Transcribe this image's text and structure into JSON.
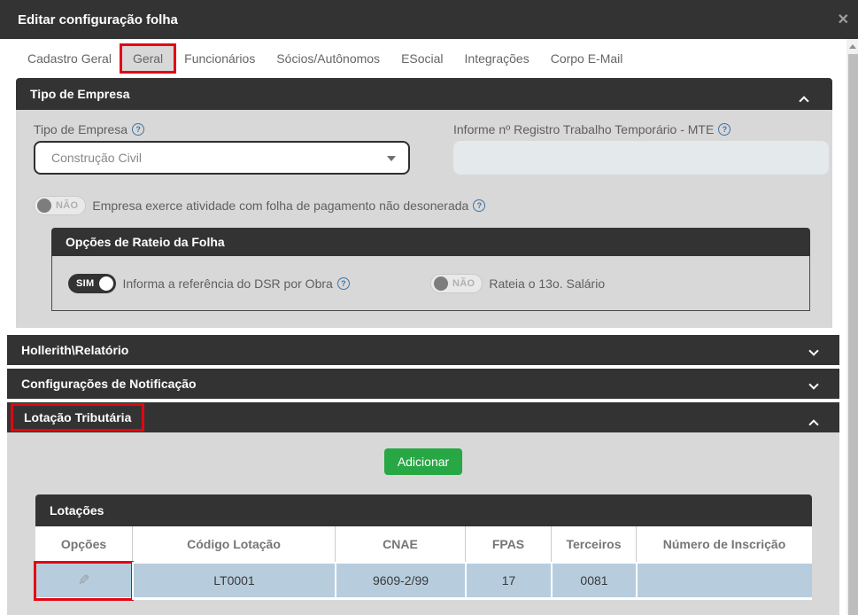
{
  "modal": {
    "title": "Editar configuração folha"
  },
  "icons": {
    "close": "✕",
    "help": "?",
    "pencil": "✎"
  },
  "colors": {
    "header_dark": "#333333",
    "panel_gray": "#d8d8d8",
    "row_blue": "#b7cdde",
    "accent_green": "#28a745",
    "annotation_red": "#e20613",
    "help_blue": "#3f72a6"
  },
  "tabs": [
    {
      "label": "Cadastro Geral"
    },
    {
      "label": "Geral"
    },
    {
      "label": "Funcionários"
    },
    {
      "label": "Sócios/Autônomos"
    },
    {
      "label": "ESocial"
    },
    {
      "label": "Integrações"
    },
    {
      "label": "Corpo E-Mail"
    }
  ],
  "tipo_empresa": {
    "section_title": "Tipo de Empresa",
    "tipo_label": "Tipo de Empresa",
    "tipo_value": "Construção Civil",
    "mte_label": "Informe nº Registro Trabalho Temporário - MTE",
    "mte_value": "",
    "desonerada_toggle": "NÃO",
    "desonerada_label": "Empresa exerce atividade com folha de pagamento não desonerada",
    "rateio": {
      "section_title": "Opções de Rateio da Folha",
      "dsr_toggle": "SIM",
      "dsr_label": "Informa a referência do DSR por Obra",
      "salario13_toggle": "NÃO",
      "salario13_label": "Rateia o 13o. Salário"
    }
  },
  "accordions": [
    {
      "label": "Hollerith\\Relatório"
    },
    {
      "label": "Configurações de Notificação"
    },
    {
      "label": "Lotação Tributária"
    }
  ],
  "lotacao": {
    "add_button": "Adicionar",
    "table_title": "Lotações",
    "columns": [
      "Opções",
      "Código Lotação",
      "CNAE",
      "FPAS",
      "Terceiros",
      "Número de Inscrição"
    ],
    "rows": [
      {
        "codigo": "LT0001",
        "cnae": "9609-2/99",
        "fpas": "17",
        "terceiros": "0081",
        "inscricao": ""
      }
    ]
  }
}
